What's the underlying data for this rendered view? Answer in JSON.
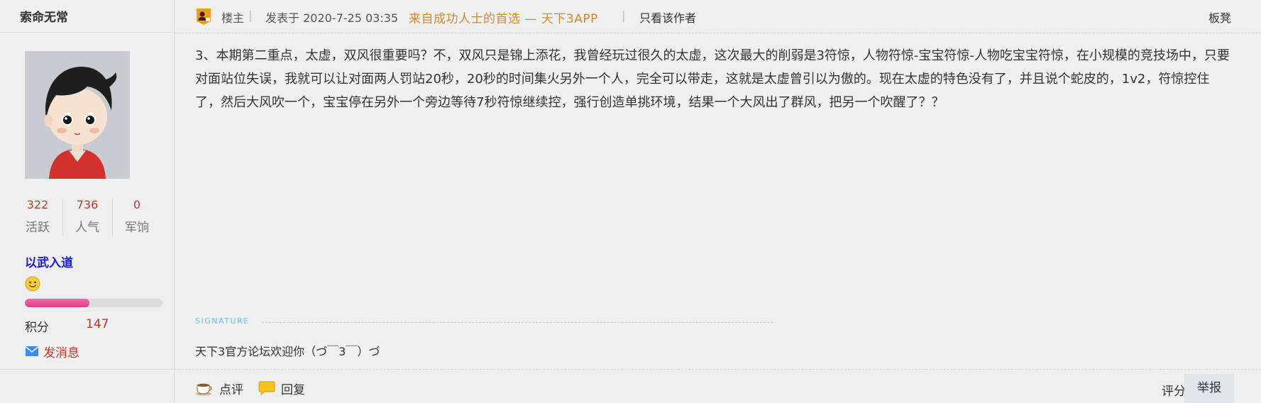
{
  "user": {
    "name": "索命无常",
    "stats": [
      {
        "value": "322",
        "label": "活跃"
      },
      {
        "value": "736",
        "label": "人气"
      },
      {
        "value": "0",
        "label": "军饷"
      }
    ],
    "rank_title": "以武入道",
    "level_progress_percent": 47,
    "points_label": "积分",
    "points_value": "147",
    "send_message_label": "发消息"
  },
  "post": {
    "op_label": "楼主",
    "separator": "|",
    "posted_at": "发表于 2020-7-25 03:35",
    "promo_text": "来自成功人士的首选 — 天下3APP",
    "author_only_label": "只看该作者",
    "floor_name": "板凳",
    "body": "3、本期第二重点，太虚，双风很重要吗？不，双风只是锦上添花，我曾经玩过很久的太虚，这次最大的削弱是3符惊，人物符惊-宝宝符惊-人物吃宝宝符惊，在小规模的竞技场中，只要对面站位失误，我就可以让对面两人罚站20秒，20秒的时间集火另外一个人，完全可以带走，这就是太虚曾引以为傲的。现在太虚的特色没有了，并且说个蛇皮的，1v2，符惊控住了，然后大风吹一个，宝宝停在另外一个旁边等待7秒符惊继续控，强行创造单挑环境，结果一个大风出了群风，把另一个吹醒了？？",
    "signature_label": "SIGNATURE",
    "signature_text": "天下3官方论坛欢迎你（づ￣3￣）づ",
    "actions": {
      "comment_label": "点评",
      "reply_label": "回复",
      "rate_label": "评分",
      "report_label": "举报"
    }
  },
  "colors": {
    "accent_red": "#c0392b",
    "rank_blue": "#1a1adc",
    "promo_orange": "#d08a2e",
    "signature_blue": "#6cc1dc",
    "progress_pink": "#e33d8a"
  }
}
